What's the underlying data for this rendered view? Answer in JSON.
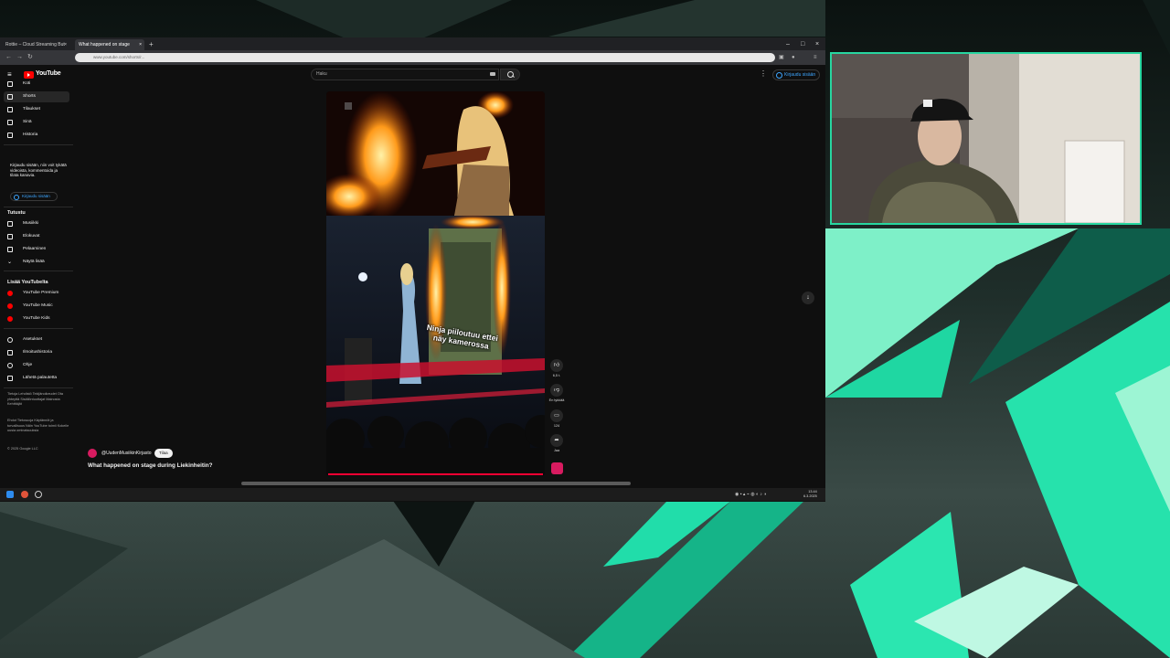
{
  "browser": {
    "tabs": [
      {
        "title": "Rottie – Cloud Streaming But"
      },
      {
        "title": "What happened on stage"
      }
    ],
    "new_tab": "+",
    "url": "www.youtube.com/shorts/r...",
    "window_controls": [
      "–",
      "□",
      "×"
    ]
  },
  "youtube": {
    "logo_text": "YouTube",
    "search_placeholder": "Haku",
    "signin_label": "Kirjaudu sisään",
    "sidebar": {
      "main": [
        {
          "label": "Koti",
          "icon": "home-icon"
        },
        {
          "label": "Shorts",
          "icon": "shorts-icon",
          "active": true
        },
        {
          "label": "Tilaukset",
          "icon": "subscriptions-icon"
        },
        {
          "label": "Sinä",
          "icon": "you-icon"
        },
        {
          "label": "Historia",
          "icon": "history-icon"
        }
      ],
      "signin_note": "Kirjaudu sisään, niin voit tykätä videoista, kommentoida ja tilata kanavia.",
      "signin_button": "Kirjaudu sisään",
      "explore_heading": "Tutustu",
      "explore": [
        {
          "label": "Musiikki",
          "icon": "music-icon"
        },
        {
          "label": "Elokuvat",
          "icon": "movies-icon"
        },
        {
          "label": "Pelaaminen",
          "icon": "gaming-icon"
        },
        {
          "label": "Näytä lisää",
          "icon": "chevron-down-icon"
        }
      ],
      "more_heading": "Lisää YouTubelta",
      "more": [
        {
          "label": "YouTube Premium"
        },
        {
          "label": "YouTube Music"
        },
        {
          "label": "YouTube Kids"
        }
      ],
      "settings": [
        {
          "label": "Asetukset",
          "icon": "gear-icon"
        },
        {
          "label": "Ilmoitushistoria",
          "icon": "flag-icon"
        },
        {
          "label": "Ohje",
          "icon": "help-icon"
        },
        {
          "label": "Lähetä palautetta",
          "icon": "feedback-icon"
        }
      ],
      "footer_1": "Tietoja  Lehdistö  Tekijänoikeudet  Ota yhteyttä  Sisällöntuottajat  Mainosta  Kehittäjät",
      "footer_2": "Ehdot  Tietosuoja  Käytännöt ja turvallisuus  Näin YouTube toimii  Kokeile uusia ominaisuuksia",
      "copyright": "© 2025 Google LLC"
    },
    "short": {
      "overlay_caption": "Ninja piiloutuu ettei näy kamerossa",
      "likes": "6,5 t.",
      "dislike_label": "En tykkää",
      "comments": "124",
      "share_label": "Jaa"
    },
    "channel": {
      "handle": "@UudenMusiikinKirjasto",
      "subscribe_label": "Tilaa"
    },
    "video_title": "What happened on stage during Liekinheitin?"
  },
  "taskbar": {
    "time": "13.44",
    "date": "6.3.2025"
  },
  "colors": {
    "stream_accent": "#27d6a0",
    "youtube_red": "#ff0000",
    "link_blue": "#3ea6ff"
  }
}
